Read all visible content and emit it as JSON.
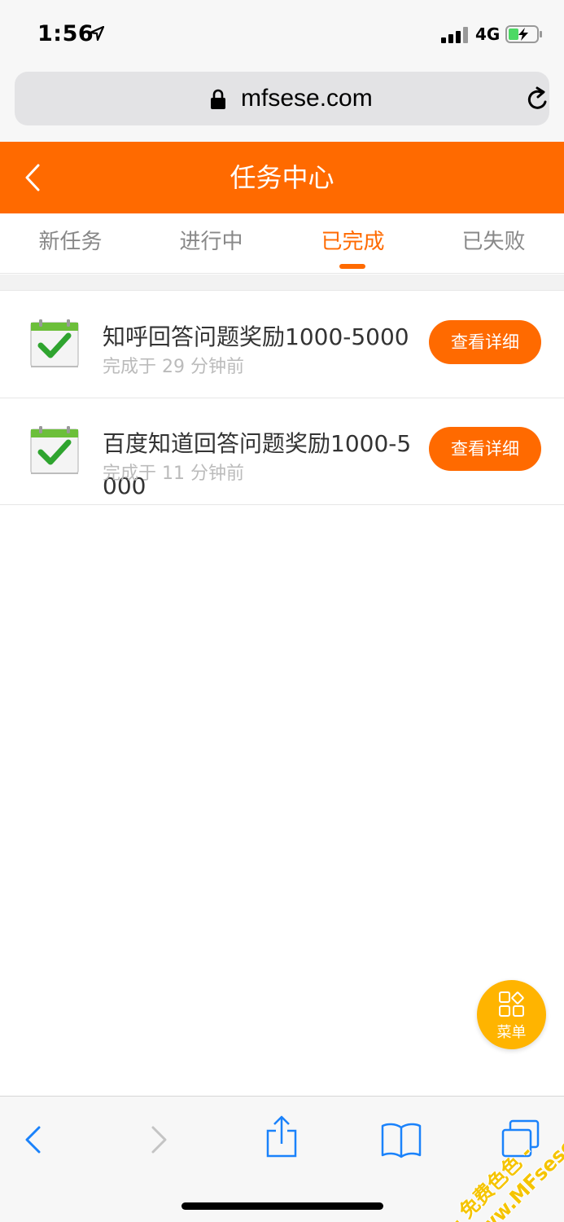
{
  "status_bar": {
    "time": "1:56",
    "network": "4G"
  },
  "browser": {
    "url": "mfsese.com"
  },
  "header": {
    "title": "任务中心"
  },
  "tabs": [
    {
      "label": "新任务",
      "active": false
    },
    {
      "label": "进行中",
      "active": false
    },
    {
      "label": "已完成",
      "active": true
    },
    {
      "label": "已失败",
      "active": false
    }
  ],
  "tasks": [
    {
      "title": "知呼回答问题奖励1000-5000",
      "time": "完成于 29 分钟前",
      "button": "查看详细"
    },
    {
      "title": "百度知道回答问题奖励1000-5000",
      "time": "完成于 11 分钟前",
      "button": "查看详细"
    }
  ],
  "fab": {
    "label": "菜单",
    "icon": "grid-icon"
  },
  "watermark": {
    "line1": "- 免费色色 -",
    "line2": "www.MFsese.com"
  },
  "colors": {
    "accent": "#ff6a00",
    "fab": "#ffb400",
    "ios_blue": "#1a82fb"
  }
}
